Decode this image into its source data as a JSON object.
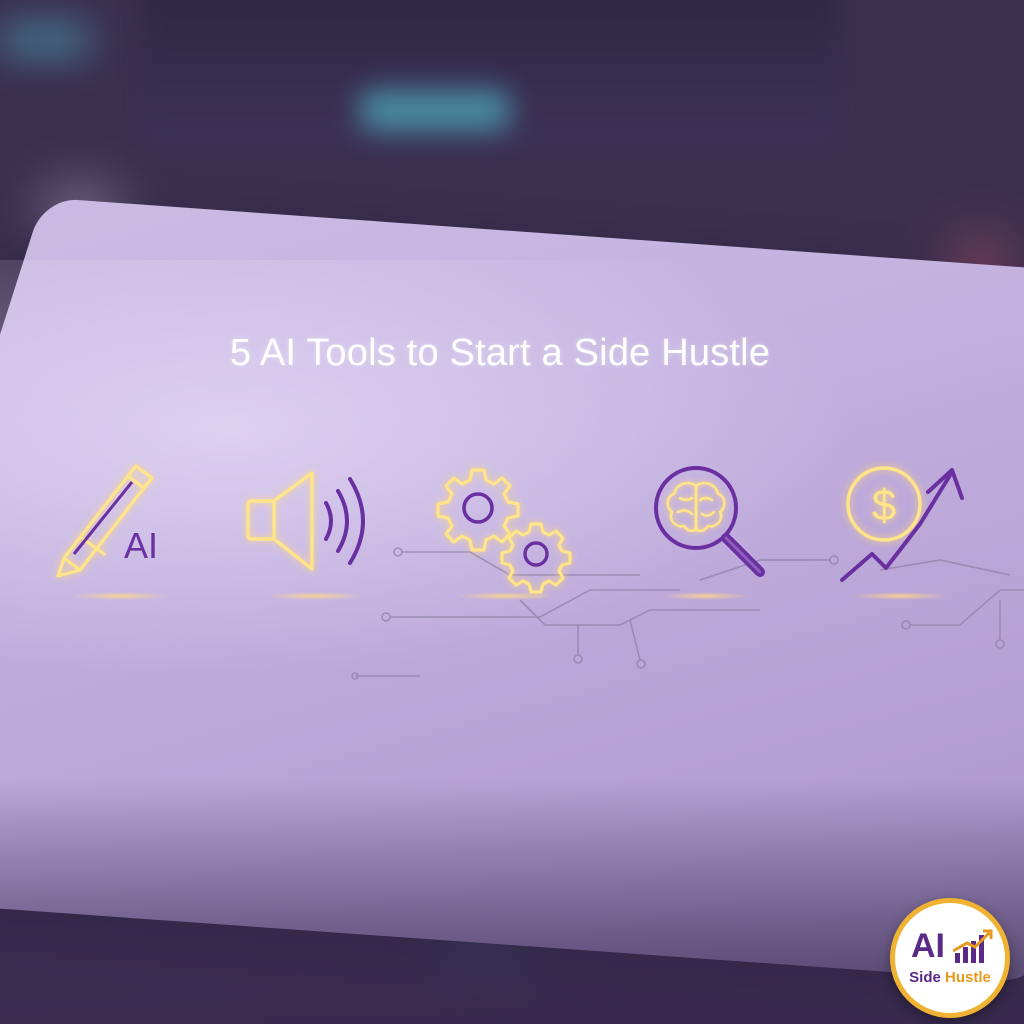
{
  "title": "5 AI Tools to Start a Side Hustle",
  "icons": [
    {
      "name": "pencil-ai-icon",
      "text": "AI"
    },
    {
      "name": "speaker-icon"
    },
    {
      "name": "gears-icon"
    },
    {
      "name": "brain-magnifier-icon"
    },
    {
      "name": "dollar-growth-icon",
      "text": "$"
    }
  ],
  "logo": {
    "ai": "AI",
    "word1": "Side",
    "word2": "Hustle"
  },
  "colors": {
    "neon_yellow": "#ffe48a",
    "neon_purple": "#6a2fa0",
    "logo_ring": "#f0b233"
  }
}
